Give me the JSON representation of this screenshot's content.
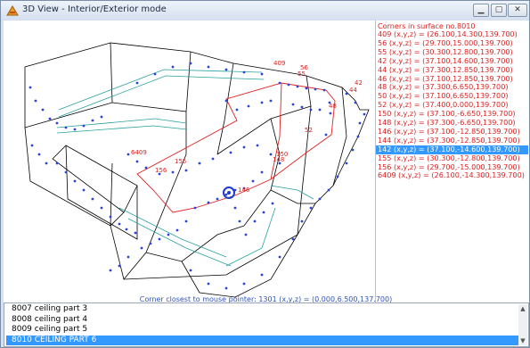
{
  "window": {
    "title": "3D View - Interior/Exterior mode",
    "controls": [
      "minimize",
      "maximize",
      "close"
    ]
  },
  "corners_panel": {
    "header": "Corners in surface no.8010",
    "rows": [
      "409  (x,y,z) = (26.100,14.300,139.700)",
      "56  (x,y,z) = (29.700,15.000,139.700)",
      "55  (x,y,z) = (30.300,12.800,139.700)",
      "42  (x,y,z) = (37.100,14.600,139.700)",
      "44  (x,y,z) = (37.300,12.850,139.700)",
      "46  (x,y,z) = (37.100,12.850,139.700)",
      "48  (x,y,z) = (37.300,6.650,139.700)",
      "50  (x,y,z) = (37.100,6.650,139.700)",
      "52  (x,y,z) = (37.400,0.000,139.700)",
      "150  (x,y,z) = (37.100,-6.650,139.700)",
      "148  (x,y,z) = (37.300,-6.650,139.700)",
      "146  (x,y,z) = (37.100,-12.850,139.700)",
      "144  (x,y,z) = (37.300,-12.850,139.700)",
      "142  (x,y,z) = (37.100,-14.600,139.700)",
      "155  (x,y,z) = (30.300,-12.800,139.700)",
      "156  (x,y,z) = (29.700,-15.000,139.700)",
      "6409  (x,y,z) = (26.100,-14.300,139.700)"
    ],
    "selected_index": 13
  },
  "viewport": {
    "labels": [
      "409",
      "56",
      "55",
      "42",
      "44",
      "48",
      "52",
      "150",
      "156",
      "155",
      "6409",
      "146",
      "148"
    ]
  },
  "status": {
    "text": "Corner closest to mouse pointer: 1301  (x,y,z) = (0.000,6.500,137.700)"
  },
  "surface_list": {
    "items": [
      "8007 ceiling part 3",
      "8008 ceiling part 4",
      "8009 ceiling part 5",
      "8010 CEILING PART 6"
    ],
    "selected_index": 3
  },
  "colors": {
    "selection": "#3399ff",
    "corner_text": "#e02020",
    "status_text": "#2e52b8",
    "model_points": "#2a44d8"
  }
}
